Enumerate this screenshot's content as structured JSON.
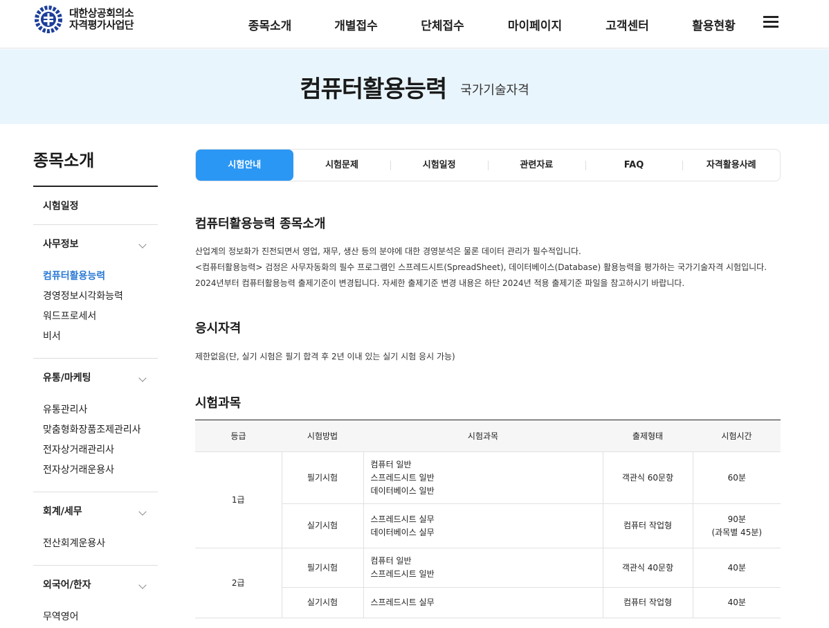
{
  "header": {
    "logo_line1": "대한상공회의소",
    "logo_line2": "자격평가사업단",
    "nav": [
      "종목소개",
      "개별접수",
      "단체접수",
      "마이페이지",
      "고객센터",
      "활용현황"
    ]
  },
  "banner": {
    "title": "컴퓨터활용능력",
    "subtitle": "국가기술자격"
  },
  "sidebar": {
    "title": "종목소개",
    "top_link": "시험일정",
    "groups": [
      {
        "label": "사무정보",
        "items": [
          "컴퓨터활용능력",
          "경영정보시각화능력",
          "워드프로세서",
          "비서"
        ]
      },
      {
        "label": "유통/마케팅",
        "items": [
          "유통관리사",
          "맞춤형화장품조제관리사",
          "전자상거래관리사",
          "전자상거래운용사"
        ]
      },
      {
        "label": "회계/세무",
        "items": [
          "전산회계운용사"
        ]
      },
      {
        "label": "외국어/한자",
        "items": [
          "무역영어"
        ]
      }
    ]
  },
  "tabs": [
    "시험안내",
    "시험문제",
    "시험일정",
    "관련자료",
    "FAQ",
    "자격활용사례"
  ],
  "intro": {
    "heading": "컴퓨터활용능력 종목소개",
    "lines": [
      "산업계의 정보화가 진전되면서 영업, 재무, 생산 등의 분야에 대한 경영분석은 물론 데이터 관리가 필수적입니다.",
      "<컴퓨터활용능력> 검정은 사무자동화의 필수 프로그램인 스프레드시트(SpreadSheet), 데이터베이스(Database) 활용능력을 평가하는 국가기술자격 시험입니다.",
      "2024년부터 컴퓨터활용능력 출제기준이 변경됩니다. 자세한 출제기준 변경 내용은 하단 2024년 적용 출제기준 파일을 참고하시기 바랍니다."
    ]
  },
  "qualification": {
    "heading": "응시자격",
    "text": "제한없음(단, 실기 시험은 필기 합격 후 2년 이내 있는 실기 시험 응시 가능)"
  },
  "subjects": {
    "heading": "시험과목",
    "columns": [
      "등급",
      "시험방법",
      "시험과목",
      "출제형태",
      "시험시간"
    ],
    "rows": [
      {
        "grade": "1급",
        "method": "필기시험",
        "subjects": [
          "컴퓨터 일반",
          "스프레드시트 일반",
          "데이터베이스 일반"
        ],
        "format": "객관식 60문항",
        "time": [
          "60분"
        ]
      },
      {
        "grade": "",
        "method": "실기시험",
        "subjects": [
          "스프레드시트 실무",
          "데이터베이스 실무"
        ],
        "format": "컴퓨터 작업형",
        "time": [
          "90분",
          "(과목별 45분)"
        ]
      },
      {
        "grade": "2급",
        "method": "필기시험",
        "subjects": [
          "컴퓨터 일반",
          "스프레드시트 일반"
        ],
        "format": "객관식 40문항",
        "time": [
          "40분"
        ]
      },
      {
        "grade": "",
        "method": "실기시험",
        "subjects": [
          "스프레드시트 실무"
        ],
        "format": "컴퓨터 작업형",
        "time": [
          "40분"
        ]
      }
    ]
  },
  "colors": {
    "accent": "#2b97f4",
    "active_link": "#2a79d6",
    "banner_bg": "#e9f5fc",
    "logo_blue": "#1d3f9a"
  }
}
